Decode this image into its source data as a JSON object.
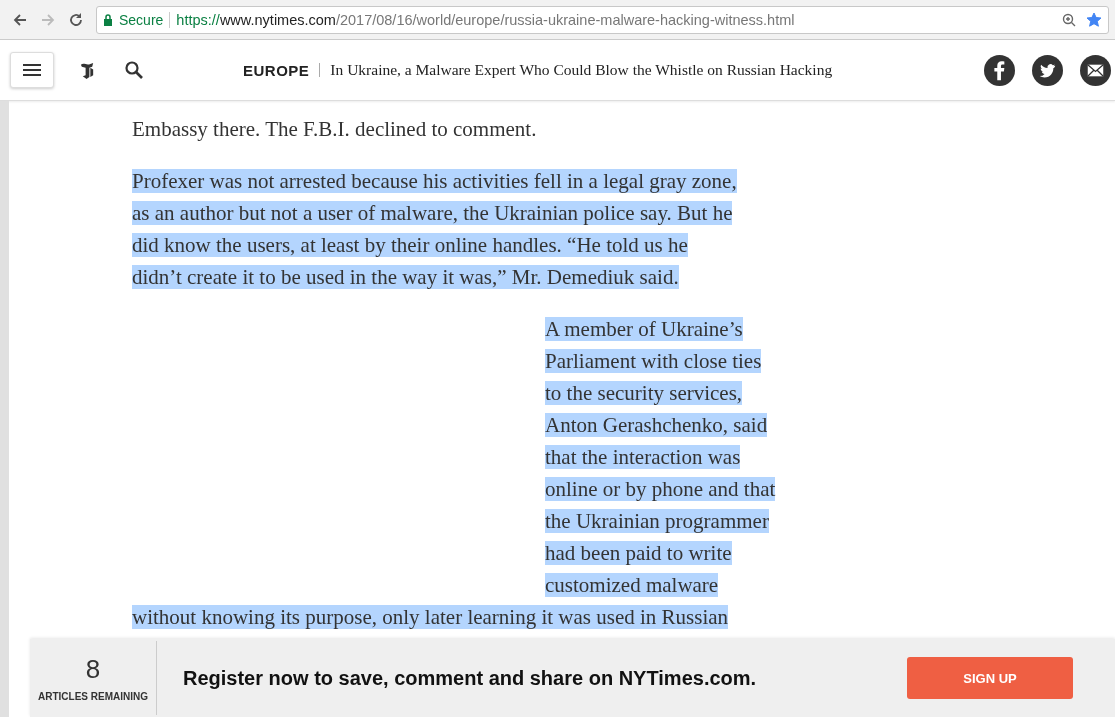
{
  "browser": {
    "secure_label": "Secure",
    "url_scheme": "https://",
    "url_host": "www.nytimes.com",
    "url_path": "/2017/08/16/world/europe/russia-ukraine-malware-hacking-witness.html",
    "bookmarked": true
  },
  "header": {
    "section": "EUROPE",
    "headline": "In Ukraine, a Malware Expert Who Could Blow the Whistle on Russian Hacking"
  },
  "article": [
    {
      "kind": "plain",
      "lines": [
        {
          "text": "Embassy there. The F.B.I. declined to comment.",
          "selected": false
        }
      ]
    },
    {
      "kind": "plain",
      "lines": [
        {
          "text": "Profexer was not arrested because his activities fell in a legal gray zone,",
          "selected": true
        },
        {
          "text": "as an author but not a user of malware, the Ukrainian police say. But he",
          "selected": true
        },
        {
          "text": "did know the users, at least by their online handles. “He told us he",
          "selected": true
        },
        {
          "text": "didn’t create it to be used in the way it was,” Mr. Demediuk said.",
          "selected": true
        }
      ]
    },
    {
      "kind": "indented",
      "lines": [
        {
          "text": "A member of Ukraine’s",
          "selected": true
        },
        {
          "text": "Parliament with close ties",
          "selected": true
        },
        {
          "text": "to the security services,",
          "selected": true
        },
        {
          "text": "Anton Gerashchenko, said",
          "selected": true
        },
        {
          "text": "that the interaction was",
          "selected": true
        },
        {
          "text": "online or by phone and that",
          "selected": true
        },
        {
          "text": "the Ukrainian programmer",
          "selected": true
        },
        {
          "text": "had been paid to write",
          "selected": true
        },
        {
          "text": "customized malware",
          "selected": true
        }
      ]
    },
    {
      "kind": "continued",
      "lines": [
        {
          "text": "without knowing its purpose, only later learning it was used in Russian",
          "selected": true
        }
      ]
    }
  ],
  "banner": {
    "count": "8",
    "count_label": "ARTICLES REMAINING",
    "message": "Register now to save, comment and share on NYTimes.com.",
    "button": "SIGN UP"
  }
}
